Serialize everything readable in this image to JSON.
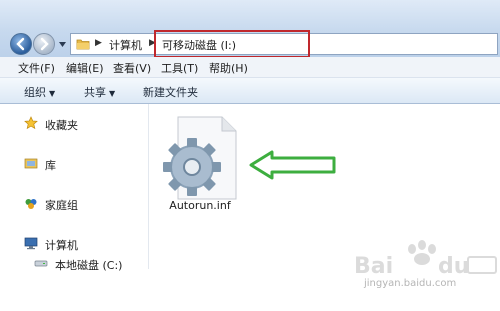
{
  "window": {
    "breadcrumb": {
      "computer": "计算机",
      "drive": "可移动磁盘 (I:)"
    }
  },
  "menu": {
    "items": [
      "文件(F)",
      "编辑(E)",
      "查看(V)",
      "工具(T)",
      "帮助(H)"
    ]
  },
  "toolbar": {
    "organize": "组织",
    "share": "共享",
    "new_folder": "新建文件夹"
  },
  "nav": {
    "favorites": "收藏夹",
    "libraries": "库",
    "homegroup": "家庭组",
    "computer": "计算机",
    "local_disk": "本地磁盘 (C:)"
  },
  "content": {
    "files": [
      {
        "name": "Autorun.inf",
        "icon": "settings-file-icon"
      }
    ],
    "annotation_color": "#3dae3f",
    "highlight_color": "#c0282d"
  },
  "watermark": {
    "domain": "jingyan.baidu.com"
  }
}
